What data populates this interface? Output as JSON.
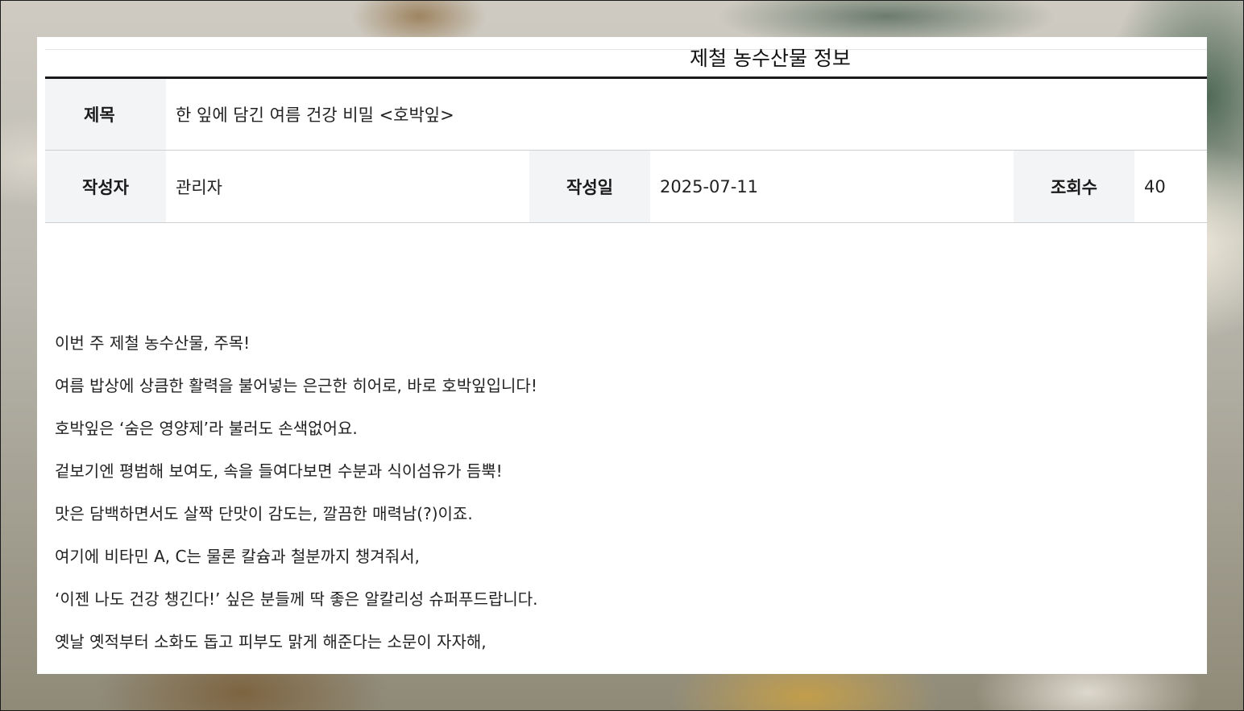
{
  "board": {
    "title": "제철 농수산물 정보"
  },
  "post": {
    "title_label": "제목",
    "title": "한 잎에 담긴 여름 건강 비밀 <호박잎>",
    "author_label": "작성자",
    "author": "관리자",
    "date_label": "작성일",
    "date": "2025-07-11",
    "views_label": "조회수",
    "views": "40"
  },
  "content": {
    "paragraphs": [
      "이번 주 제철 농수산물, 주목!",
      "여름 밥상에 상큼한 활력을 불어넣는 은근한 히어로, 바로 호박잎입니다!",
      "호박잎은 ‘숨은 영양제’라 불러도 손색없어요.",
      "겉보기엔 평범해 보여도, 속을 들여다보면 수분과 식이섬유가 듬뿍!",
      "맛은 담백하면서도 살짝 단맛이 감도는, 깔끔한 매력남(?)이죠.",
      "여기에 비타민 A, C는 물론 칼슘과 철분까지 챙겨줘서,",
      "‘이젠 나도 건강 챙긴다!’ 싶은 분들께 딱 좋은 알칼리성 슈퍼푸드랍니다.",
      "옛날 옛적부터 소화도 돕고 피부도 맑게 해준다는 소문이 자자해,"
    ]
  }
}
